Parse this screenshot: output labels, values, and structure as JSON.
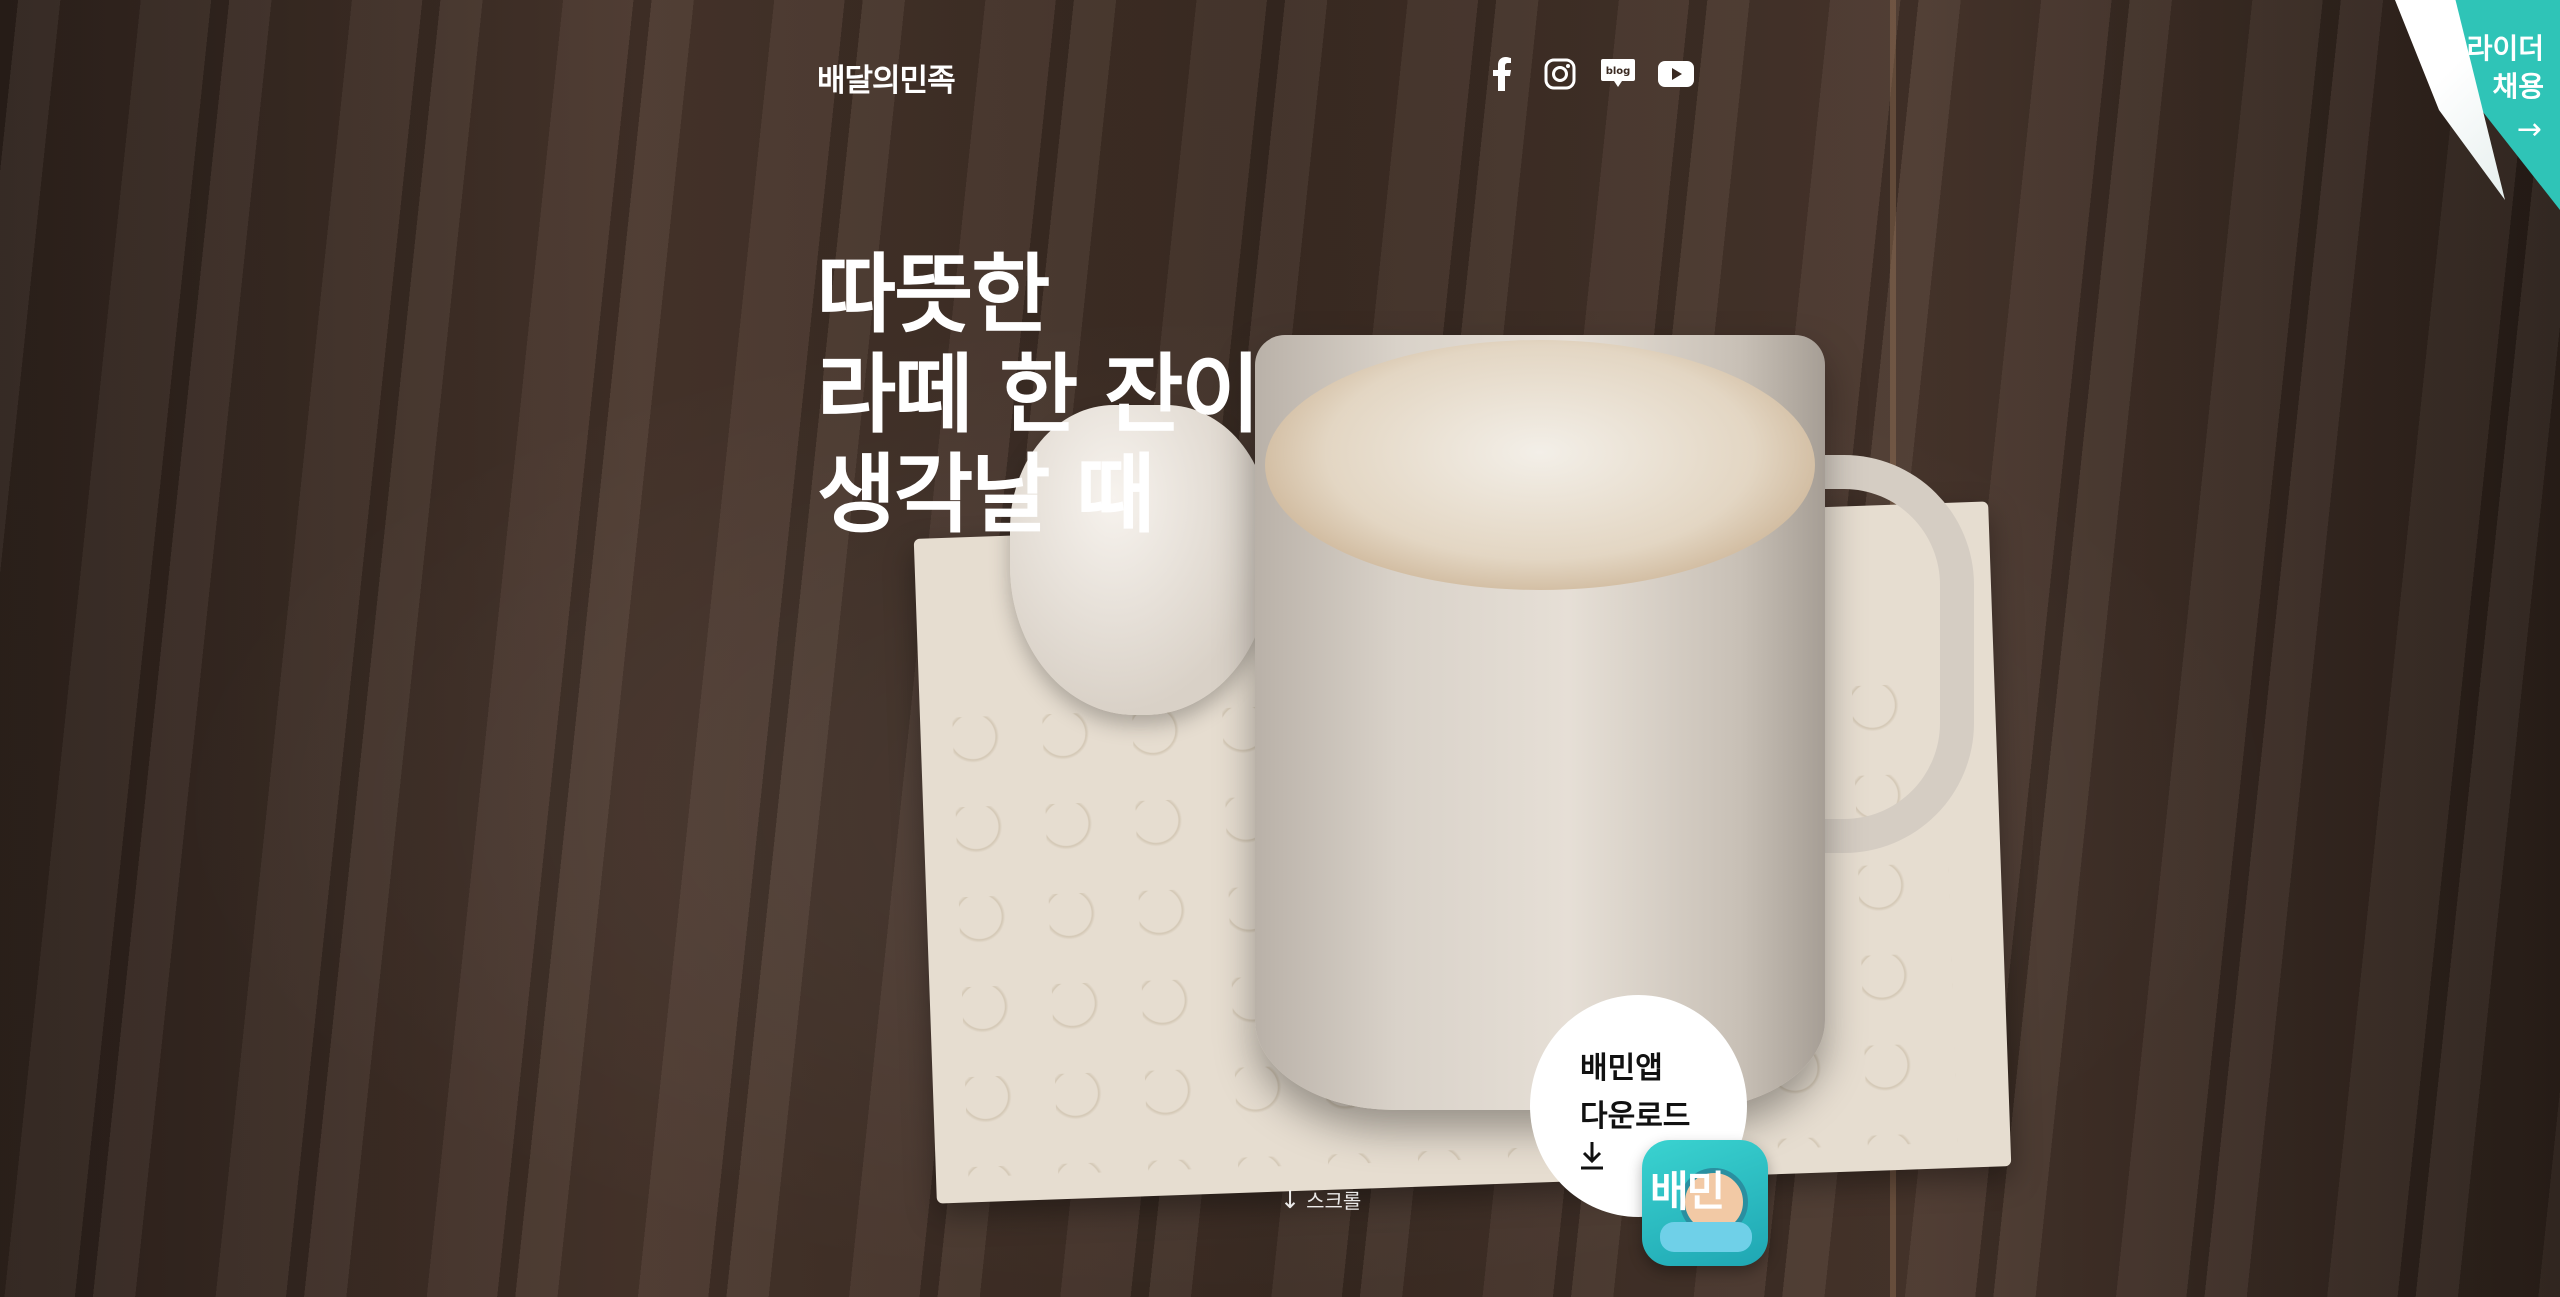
{
  "header": {
    "logo_text": "배달의민족",
    "socials": [
      {
        "name": "facebook-icon"
      },
      {
        "name": "instagram-icon"
      },
      {
        "name": "blog-icon",
        "label": "blog"
      },
      {
        "name": "youtube-icon"
      }
    ]
  },
  "hero": {
    "headline_line1": "따뜻한",
    "headline_line2": "라떼 한 잔이",
    "headline_line3": "생각날 때"
  },
  "scroll": {
    "label": "스크롤"
  },
  "download": {
    "line1": "배민앱",
    "line2": "다운로드",
    "app_icon_text": "배민"
  },
  "recruit": {
    "line1": "라이더",
    "line2": "채용"
  },
  "colors": {
    "accent_teal": "#2fc4b7",
    "text_white": "#ffffff"
  }
}
